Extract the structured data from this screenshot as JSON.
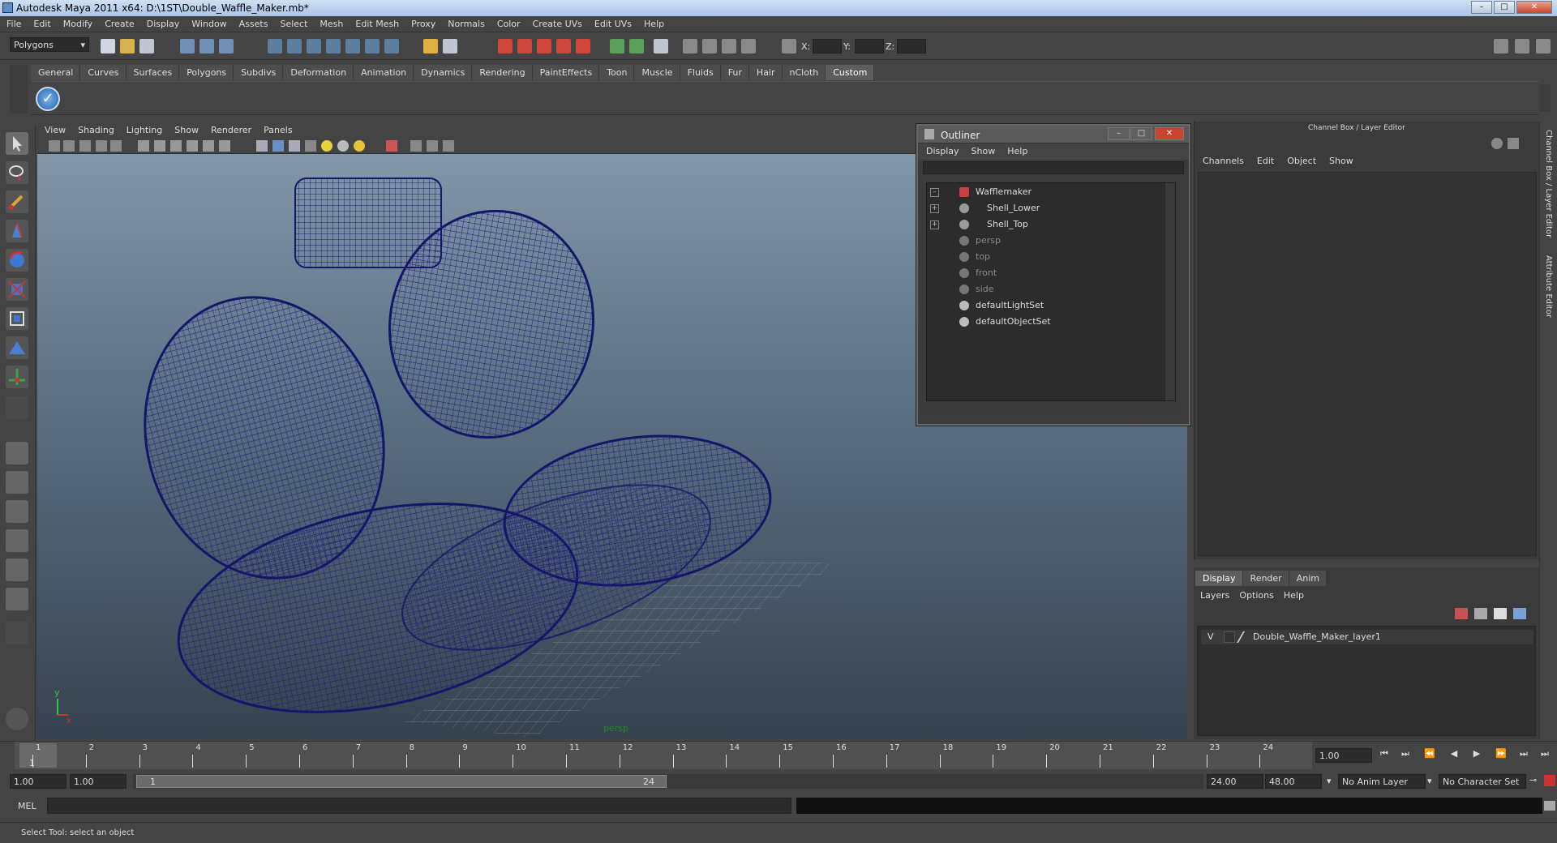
{
  "window": {
    "title": "Autodesk Maya 2011 x64: D:\\1ST\\Double_Waffle_Maker.mb*"
  },
  "menubar": [
    "File",
    "Edit",
    "Modify",
    "Create",
    "Display",
    "Window",
    "Assets",
    "Select",
    "Mesh",
    "Edit Mesh",
    "Proxy",
    "Normals",
    "Color",
    "Create UVs",
    "Edit UVs",
    "Help"
  ],
  "statusline": {
    "mode": "Polygons",
    "x_label": "X:",
    "y_label": "Y:",
    "z_label": "Z:"
  },
  "shelf_tabs": [
    "General",
    "Curves",
    "Surfaces",
    "Polygons",
    "Subdivs",
    "Deformation",
    "Animation",
    "Dynamics",
    "Rendering",
    "PaintEffects",
    "Toon",
    "Muscle",
    "Fluids",
    "Fur",
    "Hair",
    "nCloth",
    "Custom"
  ],
  "shelf_active": "Custom",
  "viewport": {
    "menu": [
      "View",
      "Shading",
      "Lighting",
      "Show",
      "Renderer",
      "Panels"
    ],
    "camera_label": "persp",
    "axis_y": "y",
    "axis_x": "x",
    "wire_color": "#1a1a7a"
  },
  "outliner": {
    "title": "Outliner",
    "menu": [
      "Display",
      "Show",
      "Help"
    ],
    "items": [
      {
        "label": "Wafflemaker"
      },
      {
        "label": "Shell_Lower"
      },
      {
        "label": "Shell_Top"
      },
      {
        "label": "persp"
      },
      {
        "label": "top"
      },
      {
        "label": "front"
      },
      {
        "label": "side"
      },
      {
        "label": "defaultLightSet"
      },
      {
        "label": "defaultObjectSet"
      }
    ]
  },
  "channel_box": {
    "header": "Channel Box / Layer Editor",
    "menu": [
      "Channels",
      "Edit",
      "Object",
      "Show"
    ]
  },
  "side_tabs": [
    "Channel Box / Layer Editor",
    "Attribute Editor"
  ],
  "layer_editor": {
    "tabs": [
      "Display",
      "Render",
      "Anim"
    ],
    "menu": [
      "Layers",
      "Options",
      "Help"
    ],
    "layer": {
      "visible": "V",
      "name": "Double_Waffle_Maker_layer1"
    }
  },
  "time_slider": {
    "ticks": [
      "1",
      "2",
      "3",
      "4",
      "5",
      "6",
      "7",
      "8",
      "9",
      "10",
      "11",
      "12",
      "13",
      "14",
      "15",
      "16",
      "17",
      "18",
      "19",
      "20",
      "21",
      "22",
      "23",
      "24"
    ],
    "current_frame": "1",
    "current_time_field": "1.00"
  },
  "range_slider": {
    "start_time": "1.00",
    "start_playback": "1.00",
    "range_start": "1",
    "range_end": "24",
    "end_playback": "24.00",
    "end_time": "48.00",
    "anim_layer": "No Anim Layer",
    "character_set": "No Character Set"
  },
  "command_line": {
    "label": "MEL"
  },
  "help_line": {
    "text": "Select Tool: select an object"
  }
}
